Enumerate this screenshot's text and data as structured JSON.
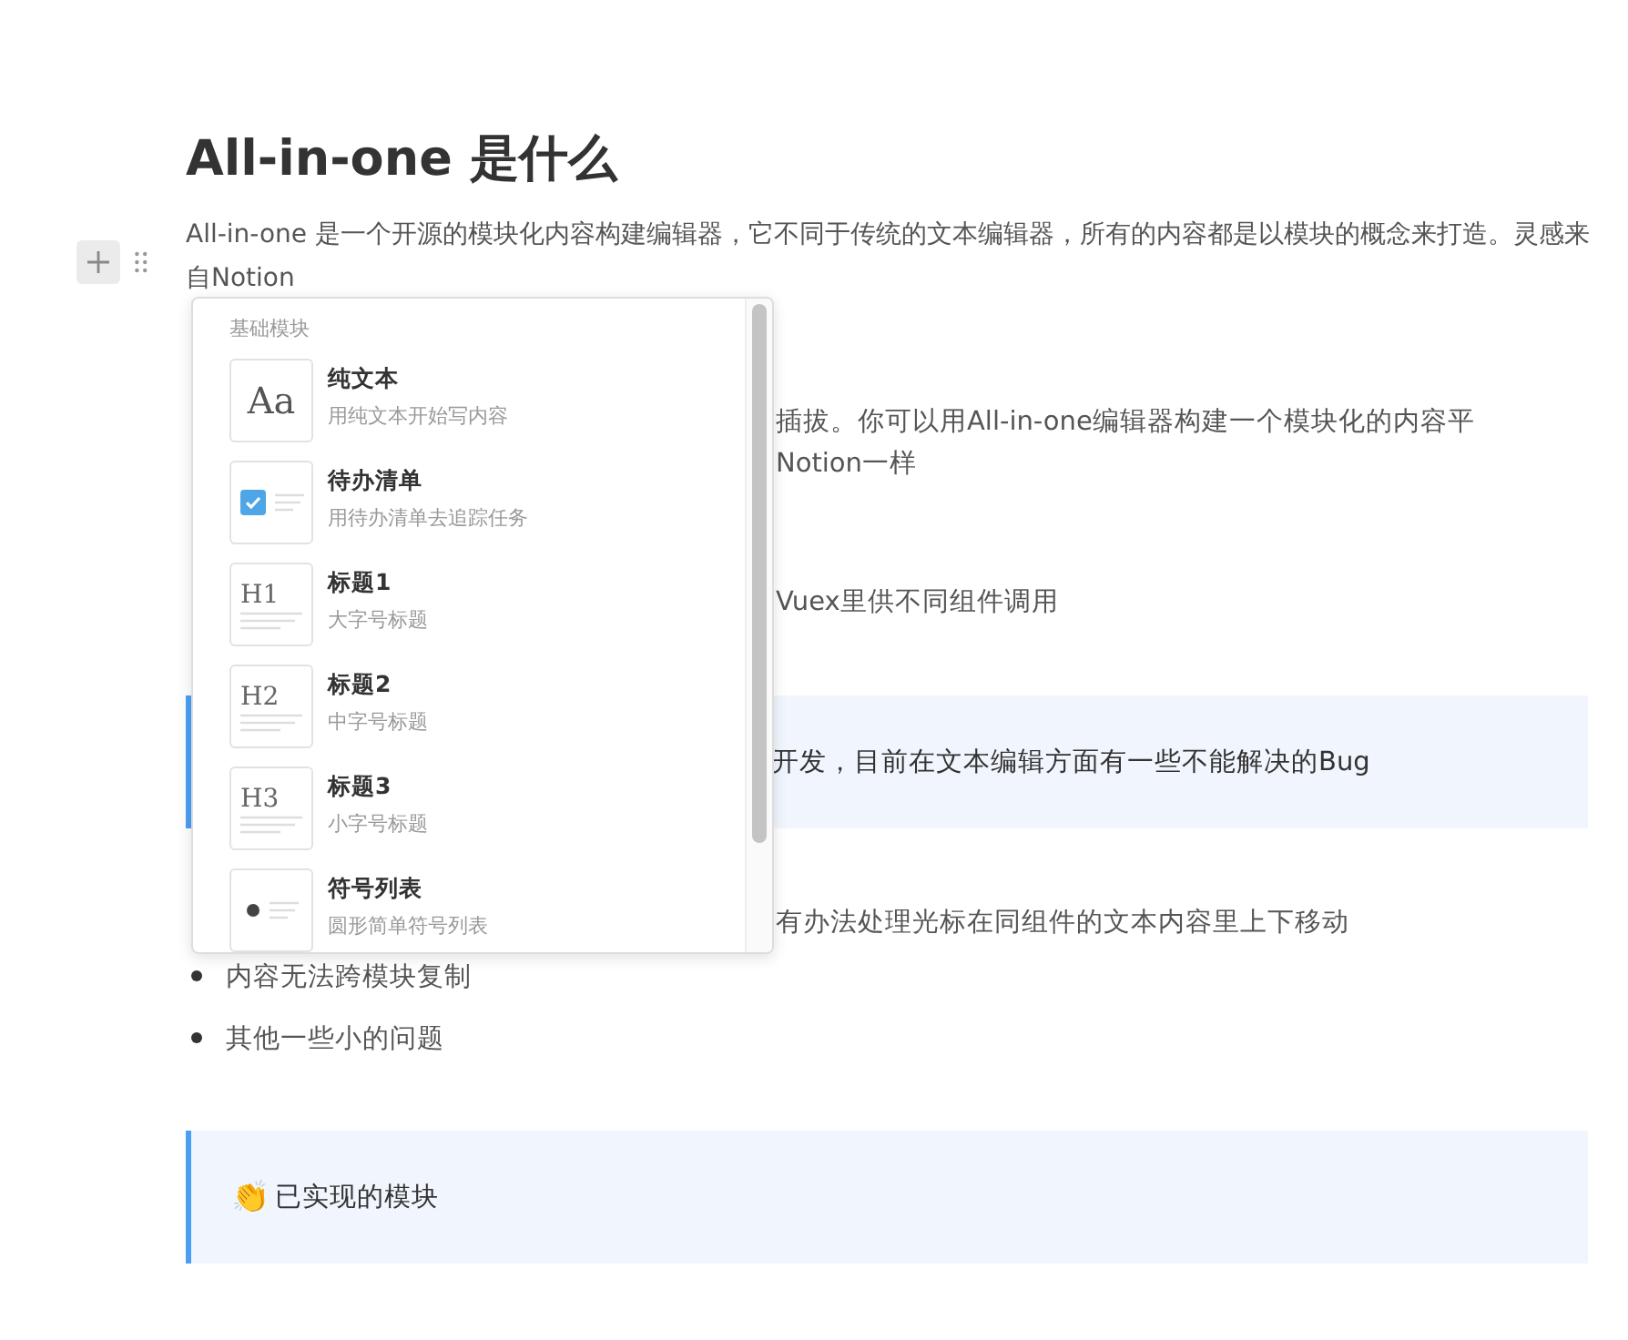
{
  "title": "All-in-one 是什么",
  "intro": "All-in-one 是一个开源的模块化内容构建编辑器，它不同于传统的文本编辑器，所有的内容都是以模块的概念来打造。灵感来自Notion",
  "partial_paragraph": [
    "插拔。你可以用All-in-one编辑器构建一个模块化的内容平",
    "Notion一样"
  ],
  "partial_line": "Vuex里供不同组件调用",
  "warning_callout": "开发，目前在文本编辑方面有一些不能解决的Bug",
  "partial_bullet": "有办法处理光标在同组件的文本内容里上下移动",
  "bullets": [
    "内容无法跨模块复制",
    "其他一些小的问题"
  ],
  "done_callout": {
    "emoji": "👏",
    "text": "已实现的模块"
  },
  "menu": {
    "section": "基础模块",
    "items": [
      {
        "kind": "text",
        "glyph": "Aa",
        "title": "纯文本",
        "subtitle": "用纯文本开始写内容"
      },
      {
        "kind": "todo",
        "title": "待办清单",
        "subtitle": "用待办清单去追踪任务"
      },
      {
        "kind": "heading",
        "glyph": "H1",
        "title": "标题1",
        "subtitle": "大字号标题"
      },
      {
        "kind": "heading",
        "glyph": "H2",
        "title": "标题2",
        "subtitle": "中字号标题"
      },
      {
        "kind": "heading",
        "glyph": "H3",
        "title": "标题3",
        "subtitle": "小字号标题"
      },
      {
        "kind": "bullet",
        "title": "符号列表",
        "subtitle": "圆形简单符号列表"
      }
    ]
  }
}
